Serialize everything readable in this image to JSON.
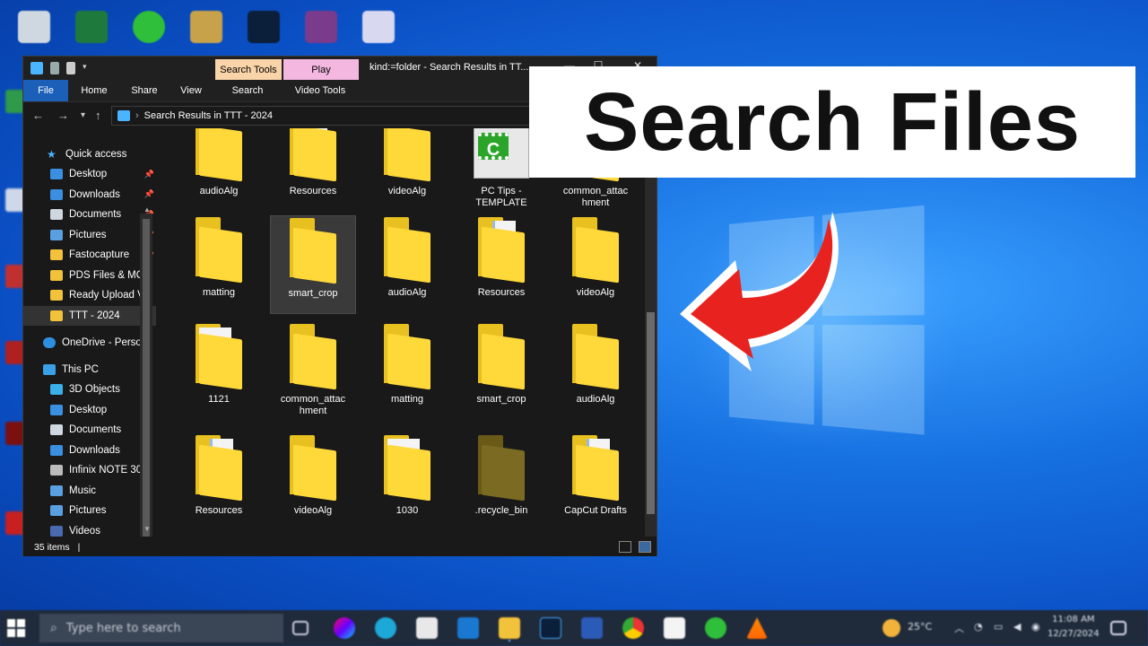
{
  "banner": {
    "text": "Search Files"
  },
  "explorer": {
    "context_tabs": {
      "search_tools": "Search Tools",
      "play": "Play"
    },
    "window_title": "kind:=folder - Search Results in TT...",
    "window_controls": {
      "minimize": "—",
      "maximize": "☐",
      "close": "✕"
    },
    "ribbon_tabs": {
      "file": "File",
      "home": "Home",
      "share": "Share",
      "view": "View",
      "search": "Search",
      "video_tools": "Video Tools"
    },
    "nav": {
      "back": "←",
      "forward": "→",
      "recent": "▾",
      "up": "↑",
      "address_separator": "›",
      "address_path": "Search Results in TTT - 2024"
    },
    "sidebar": {
      "quick_access": "Quick access",
      "items": [
        {
          "label": "Desktop",
          "pinned": true
        },
        {
          "label": "Downloads",
          "pinned": true
        },
        {
          "label": "Documents",
          "pinned": true
        },
        {
          "label": "Pictures",
          "pinned": true
        },
        {
          "label": "Fastocapture",
          "pinned": true
        },
        {
          "label": "PDS Files & MO("
        },
        {
          "label": "Ready Upload Vi"
        },
        {
          "label": "TTT - 2024"
        }
      ],
      "onedrive": "OneDrive - Persor",
      "this_pc": "This PC",
      "pc_items": [
        {
          "label": "3D Objects"
        },
        {
          "label": "Desktop"
        },
        {
          "label": "Documents"
        },
        {
          "label": "Downloads"
        },
        {
          "label": "Infinix NOTE 30"
        },
        {
          "label": "Music"
        },
        {
          "label": "Pictures"
        },
        {
          "label": "Videos"
        }
      ],
      "pin_glyph": "📌"
    },
    "tiles": [
      {
        "label": "audioAlg",
        "kind": "folder"
      },
      {
        "label": "Resources",
        "kind": "folder-docs"
      },
      {
        "label": "videoAlg",
        "kind": "folder"
      },
      {
        "label": "PC Tips - TEMPLATE",
        "kind": "video",
        "glyph": "C"
      },
      {
        "label": "common_attac hment",
        "kind": "folder"
      },
      {
        "label": "matting",
        "kind": "folder"
      },
      {
        "label": "smart_crop",
        "kind": "folder",
        "selected": true
      },
      {
        "label": "audioAlg",
        "kind": "folder"
      },
      {
        "label": "Resources",
        "kind": "folder-docs"
      },
      {
        "label": "videoAlg",
        "kind": "folder"
      },
      {
        "label": "1121",
        "kind": "folder-papers"
      },
      {
        "label": "common_attac hment",
        "kind": "folder"
      },
      {
        "label": "matting",
        "kind": "folder"
      },
      {
        "label": "smart_crop",
        "kind": "folder"
      },
      {
        "label": "audioAlg",
        "kind": "folder"
      },
      {
        "label": "Resources",
        "kind": "folder-docs"
      },
      {
        "label": "videoAlg",
        "kind": "folder"
      },
      {
        "label": "1030",
        "kind": "folder-papers"
      },
      {
        "label": ".recycle_bin",
        "kind": "folder-hidden"
      },
      {
        "label": "CapCut Drafts",
        "kind": "folder-docs"
      }
    ],
    "status": {
      "item_count": "35 items",
      "cursor": "|"
    }
  },
  "taskbar": {
    "search_placeholder": "Type here to search",
    "weather": "25°C",
    "time": "11:08 AM",
    "date": "12/27/2024"
  }
}
